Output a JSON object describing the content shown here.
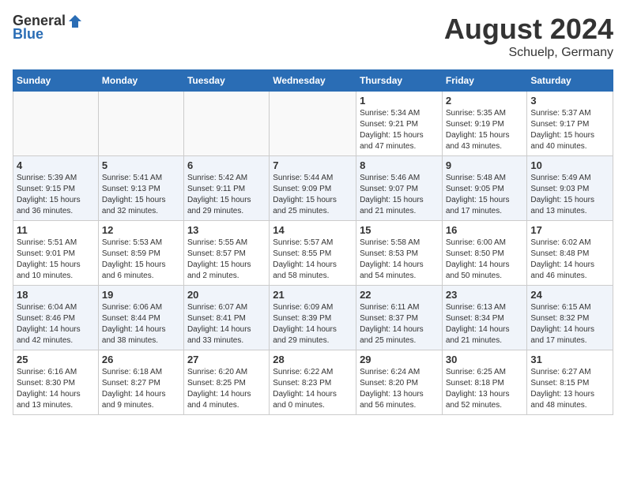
{
  "header": {
    "logo_general": "General",
    "logo_blue": "Blue",
    "month_title": "August 2024",
    "location": "Schuelp, Germany"
  },
  "weekdays": [
    "Sunday",
    "Monday",
    "Tuesday",
    "Wednesday",
    "Thursday",
    "Friday",
    "Saturday"
  ],
  "weeks": [
    [
      {
        "day": "",
        "info": ""
      },
      {
        "day": "",
        "info": ""
      },
      {
        "day": "",
        "info": ""
      },
      {
        "day": "",
        "info": ""
      },
      {
        "day": "1",
        "info": "Sunrise: 5:34 AM\nSunset: 9:21 PM\nDaylight: 15 hours\nand 47 minutes."
      },
      {
        "day": "2",
        "info": "Sunrise: 5:35 AM\nSunset: 9:19 PM\nDaylight: 15 hours\nand 43 minutes."
      },
      {
        "day": "3",
        "info": "Sunrise: 5:37 AM\nSunset: 9:17 PM\nDaylight: 15 hours\nand 40 minutes."
      }
    ],
    [
      {
        "day": "4",
        "info": "Sunrise: 5:39 AM\nSunset: 9:15 PM\nDaylight: 15 hours\nand 36 minutes."
      },
      {
        "day": "5",
        "info": "Sunrise: 5:41 AM\nSunset: 9:13 PM\nDaylight: 15 hours\nand 32 minutes."
      },
      {
        "day": "6",
        "info": "Sunrise: 5:42 AM\nSunset: 9:11 PM\nDaylight: 15 hours\nand 29 minutes."
      },
      {
        "day": "7",
        "info": "Sunrise: 5:44 AM\nSunset: 9:09 PM\nDaylight: 15 hours\nand 25 minutes."
      },
      {
        "day": "8",
        "info": "Sunrise: 5:46 AM\nSunset: 9:07 PM\nDaylight: 15 hours\nand 21 minutes."
      },
      {
        "day": "9",
        "info": "Sunrise: 5:48 AM\nSunset: 9:05 PM\nDaylight: 15 hours\nand 17 minutes."
      },
      {
        "day": "10",
        "info": "Sunrise: 5:49 AM\nSunset: 9:03 PM\nDaylight: 15 hours\nand 13 minutes."
      }
    ],
    [
      {
        "day": "11",
        "info": "Sunrise: 5:51 AM\nSunset: 9:01 PM\nDaylight: 15 hours\nand 10 minutes."
      },
      {
        "day": "12",
        "info": "Sunrise: 5:53 AM\nSunset: 8:59 PM\nDaylight: 15 hours\nand 6 minutes."
      },
      {
        "day": "13",
        "info": "Sunrise: 5:55 AM\nSunset: 8:57 PM\nDaylight: 15 hours\nand 2 minutes."
      },
      {
        "day": "14",
        "info": "Sunrise: 5:57 AM\nSunset: 8:55 PM\nDaylight: 14 hours\nand 58 minutes."
      },
      {
        "day": "15",
        "info": "Sunrise: 5:58 AM\nSunset: 8:53 PM\nDaylight: 14 hours\nand 54 minutes."
      },
      {
        "day": "16",
        "info": "Sunrise: 6:00 AM\nSunset: 8:50 PM\nDaylight: 14 hours\nand 50 minutes."
      },
      {
        "day": "17",
        "info": "Sunrise: 6:02 AM\nSunset: 8:48 PM\nDaylight: 14 hours\nand 46 minutes."
      }
    ],
    [
      {
        "day": "18",
        "info": "Sunrise: 6:04 AM\nSunset: 8:46 PM\nDaylight: 14 hours\nand 42 minutes."
      },
      {
        "day": "19",
        "info": "Sunrise: 6:06 AM\nSunset: 8:44 PM\nDaylight: 14 hours\nand 38 minutes."
      },
      {
        "day": "20",
        "info": "Sunrise: 6:07 AM\nSunset: 8:41 PM\nDaylight: 14 hours\nand 33 minutes."
      },
      {
        "day": "21",
        "info": "Sunrise: 6:09 AM\nSunset: 8:39 PM\nDaylight: 14 hours\nand 29 minutes."
      },
      {
        "day": "22",
        "info": "Sunrise: 6:11 AM\nSunset: 8:37 PM\nDaylight: 14 hours\nand 25 minutes."
      },
      {
        "day": "23",
        "info": "Sunrise: 6:13 AM\nSunset: 8:34 PM\nDaylight: 14 hours\nand 21 minutes."
      },
      {
        "day": "24",
        "info": "Sunrise: 6:15 AM\nSunset: 8:32 PM\nDaylight: 14 hours\nand 17 minutes."
      }
    ],
    [
      {
        "day": "25",
        "info": "Sunrise: 6:16 AM\nSunset: 8:30 PM\nDaylight: 14 hours\nand 13 minutes."
      },
      {
        "day": "26",
        "info": "Sunrise: 6:18 AM\nSunset: 8:27 PM\nDaylight: 14 hours\nand 9 minutes."
      },
      {
        "day": "27",
        "info": "Sunrise: 6:20 AM\nSunset: 8:25 PM\nDaylight: 14 hours\nand 4 minutes."
      },
      {
        "day": "28",
        "info": "Sunrise: 6:22 AM\nSunset: 8:23 PM\nDaylight: 14 hours\nand 0 minutes."
      },
      {
        "day": "29",
        "info": "Sunrise: 6:24 AM\nSunset: 8:20 PM\nDaylight: 13 hours\nand 56 minutes."
      },
      {
        "day": "30",
        "info": "Sunrise: 6:25 AM\nSunset: 8:18 PM\nDaylight: 13 hours\nand 52 minutes."
      },
      {
        "day": "31",
        "info": "Sunrise: 6:27 AM\nSunset: 8:15 PM\nDaylight: 13 hours\nand 48 minutes."
      }
    ]
  ]
}
